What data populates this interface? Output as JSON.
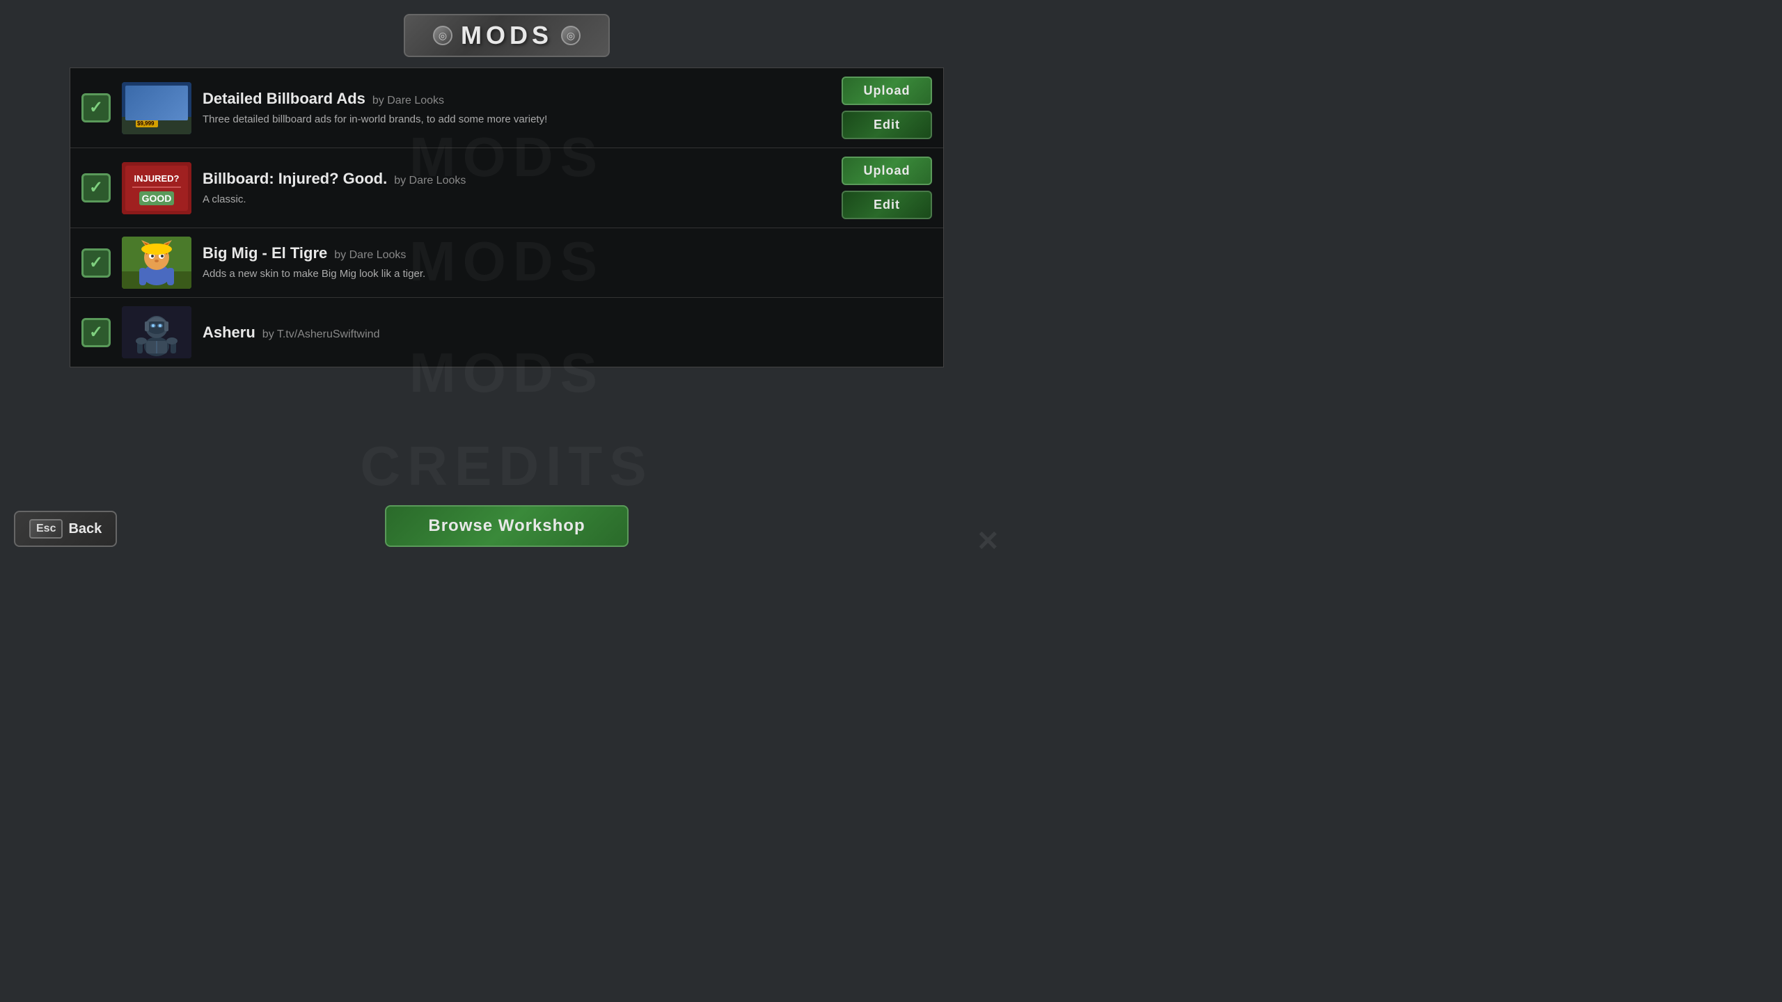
{
  "title": {
    "text": "MODS",
    "left_icon": "◎",
    "right_icon": "◎"
  },
  "watermarks": [
    "MODS",
    "MODS",
    "MODS",
    "CREDITS"
  ],
  "mods": [
    {
      "id": "detailed-billboard-ads",
      "name": "Detailed Billboard Ads",
      "author": "by Dare Looks",
      "description": "Three detailed billboard ads for in-world brands, to add some more variety!",
      "checked": true,
      "has_upload": true,
      "has_edit": true,
      "thumbnail_type": "billboard-ads",
      "price_tag": "$9,999"
    },
    {
      "id": "billboard-injured-good",
      "name": "Billboard: Injured? Good.",
      "author": "by Dare Looks",
      "description": "A classic.",
      "checked": true,
      "has_upload": true,
      "has_edit": true,
      "thumbnail_type": "injured-good"
    },
    {
      "id": "big-mig-el-tigre",
      "name": "Big Mig - El Tigre",
      "author": "by Dare Looks",
      "description": "Adds a new skin to make Big Mig look lik a tiger.",
      "checked": true,
      "has_upload": false,
      "has_edit": false,
      "thumbnail_type": "big-mig"
    },
    {
      "id": "asheru",
      "name": "Asheru",
      "author": "by T.tv/AsheruSwiftwind",
      "description": "",
      "checked": true,
      "has_upload": false,
      "has_edit": false,
      "thumbnail_type": "asheru"
    }
  ],
  "buttons": {
    "upload_label": "Upload",
    "edit_label": "Edit",
    "browse_workshop_label": "Browse Workshop",
    "back_label": "Back",
    "esc_label": "Esc"
  }
}
